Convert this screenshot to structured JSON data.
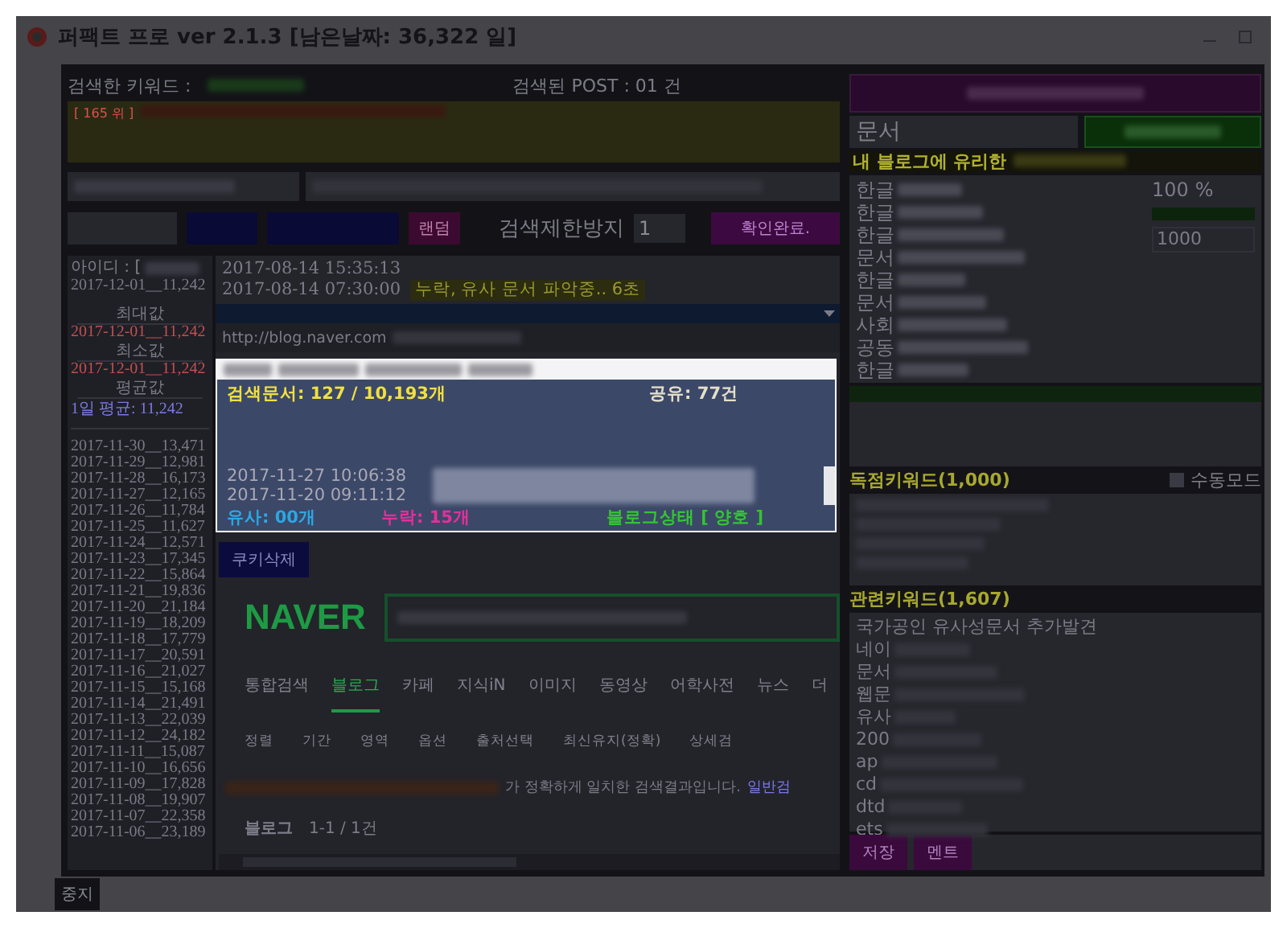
{
  "window": {
    "title": "퍼팩트 프로 ver 2.1.3 [남은날짜: 36,322 일]"
  },
  "header": {
    "keyword_label": "검색한 키워드 :",
    "post_count": "검색된 POST : 01 건",
    "rank": "[ 165 위 ]"
  },
  "controls": {
    "random_button": "랜덤",
    "limit_label": "검색제한방지",
    "limit_value": "1",
    "confirm_button": "확인완료."
  },
  "account": {
    "id_label": "아이디 : [",
    "latest": "2017-12-01__11,242",
    "max_label": "최대값",
    "max": "2017-12-01__11,242",
    "min_label": "최소값",
    "min": "2017-12-01__11,242",
    "avg_label": "평균값",
    "daily_avg": "1일 평균: 11,242",
    "history": [
      "2017-11-30__13,471",
      "2017-11-29__12,981",
      "2017-11-28__16,173",
      "2017-11-27__12,165",
      "2017-11-26__11,784",
      "2017-11-25__11,627",
      "2017-11-24__12,571",
      "2017-11-23__17,345",
      "2017-11-22__15,864",
      "2017-11-21__19,836",
      "2017-11-20__21,184",
      "2017-11-19__18,209",
      "2017-11-18__17,779",
      "2017-11-17__20,591",
      "2017-11-16__21,027",
      "2017-11-15__15,168",
      "2017-11-14__21,491",
      "2017-11-13__22,039",
      "2017-11-12__24,182",
      "2017-11-11__15,087",
      "2017-11-10__16,656",
      "2017-11-09__17,828",
      "2017-11-08__19,907",
      "2017-11-07__22,358",
      "2017-11-06__23,189"
    ]
  },
  "log": {
    "lines": [
      {
        "time": "2017-08-14 15:35:13"
      },
      {
        "time": "2017-08-14 07:30:00",
        "status": "누락, 유사 문서 파악중.. 6초"
      }
    ],
    "url": "http://blog.naver.com"
  },
  "popup": {
    "documents": "검색문서: 127 / 10,193개",
    "shares": "공유: 77건",
    "times": [
      "2017-11-27 10:06:38",
      "2017-11-20 09:11:12"
    ],
    "similar": "유사: 00개",
    "missing": "누락: 15개",
    "blog_status": "블로그상태 [ 양호 ]"
  },
  "browser": {
    "cookie_button": "쿠키삭제",
    "logo": "NAVER",
    "tabs": [
      {
        "label": "통합검색",
        "selected": false
      },
      {
        "label": "블로그",
        "selected": true
      },
      {
        "label": "카페",
        "selected": false
      },
      {
        "label": "지식iN",
        "selected": false
      },
      {
        "label": "이미지",
        "selected": false
      },
      {
        "label": "동영상",
        "selected": false
      },
      {
        "label": "어학사전",
        "selected": false
      },
      {
        "label": "뉴스",
        "selected": false
      },
      {
        "label": "더",
        "selected": false
      }
    ],
    "filters": [
      "정렬",
      "기간",
      "영역",
      "옵션",
      "출처선택",
      "최신유지(정확)",
      "상세검"
    ],
    "notice": "가 정확하게 일치한 검색결과입니다.",
    "notice_link": "일반검",
    "section": "블로그",
    "section_count": "1-1 / 1건"
  },
  "right": {
    "keyword_value": "문서",
    "favorable_title": "내 블로그에 유리한",
    "favorable_items": [
      "한글",
      "한글",
      "한글",
      "문서",
      "한글",
      "문서",
      "사회",
      "공동",
      "한글"
    ],
    "percent_value": "100",
    "percent_unit": "%",
    "count_value": "1000",
    "exclusive_title": "독점키워드(1,000)",
    "manual_mode": {
      "label": "수동모드",
      "checked": false
    },
    "related_title": "관련키워드(1,607)",
    "related_items": [
      "국가공인 유사성문서 추가발견",
      "네이",
      "문서",
      "웹문",
      "유사",
      "200",
      "ap",
      "cd",
      "dtd",
      "ets"
    ],
    "save_button": "저장",
    "comment_button": "멘트"
  },
  "stop_button": "중지"
}
